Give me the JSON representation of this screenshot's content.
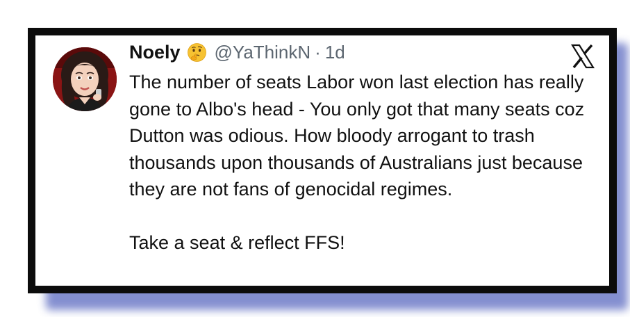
{
  "tweet": {
    "display_name": "Noely",
    "name_emoji": "thinking-face-emoji",
    "handle": "@YaThinkN",
    "separator": "·",
    "timestamp": "1d",
    "text_paragraphs": [
      "The number of seats Labor won last election has really gone to Albo's head - You only got that many seats coz Dutton was odious. How bloody arrogant to trash thousands upon thousands of Australians just because they are not fans of genocidal regimes.",
      "Take a seat & reflect FFS!"
    ]
  },
  "icons": {
    "avatar": "avatar-cartoon-woman",
    "platform_logo": "x-logo-icon"
  },
  "colors": {
    "frame": "#0c0c0c",
    "shadow": "#6f7cc8",
    "text": "#111111",
    "muted": "#5c6670"
  }
}
